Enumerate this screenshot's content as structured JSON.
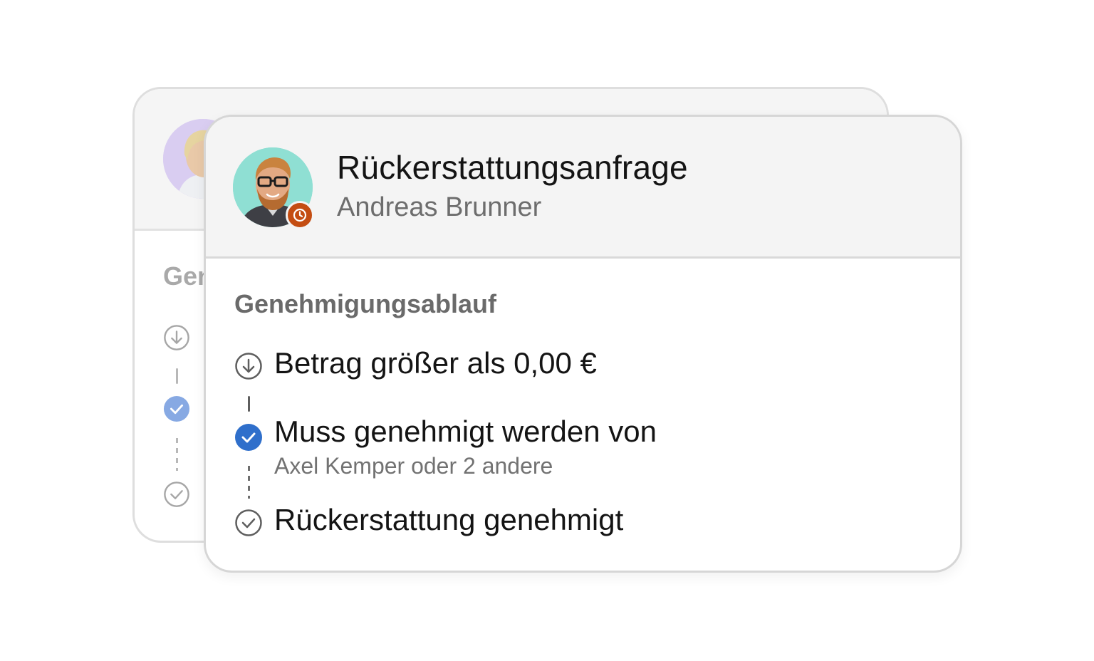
{
  "card": {
    "title": "Rückerstattungsanfrage",
    "requester": "Andreas Brunner",
    "section_title": "Genehmigungsablauf",
    "steps": [
      {
        "icon": "arrow-down-circle-icon",
        "label": "Betrag größer als 0,00 €",
        "sub": ""
      },
      {
        "icon": "check-circle-filled-icon",
        "label": "Muss genehmigt werden von",
        "sub": "Axel Kemper oder 2 andere"
      },
      {
        "icon": "check-circle-outline-icon",
        "label": "Rückerstattung genehmigt",
        "sub": ""
      }
    ]
  },
  "back_card": {
    "section_title_fragment": "Gen"
  },
  "colors": {
    "accent_blue": "#2f6fcb",
    "badge_orange": "#c44d12",
    "avatar_teal": "#8fdfd3",
    "avatar_lavender": "#d9cdf1"
  }
}
